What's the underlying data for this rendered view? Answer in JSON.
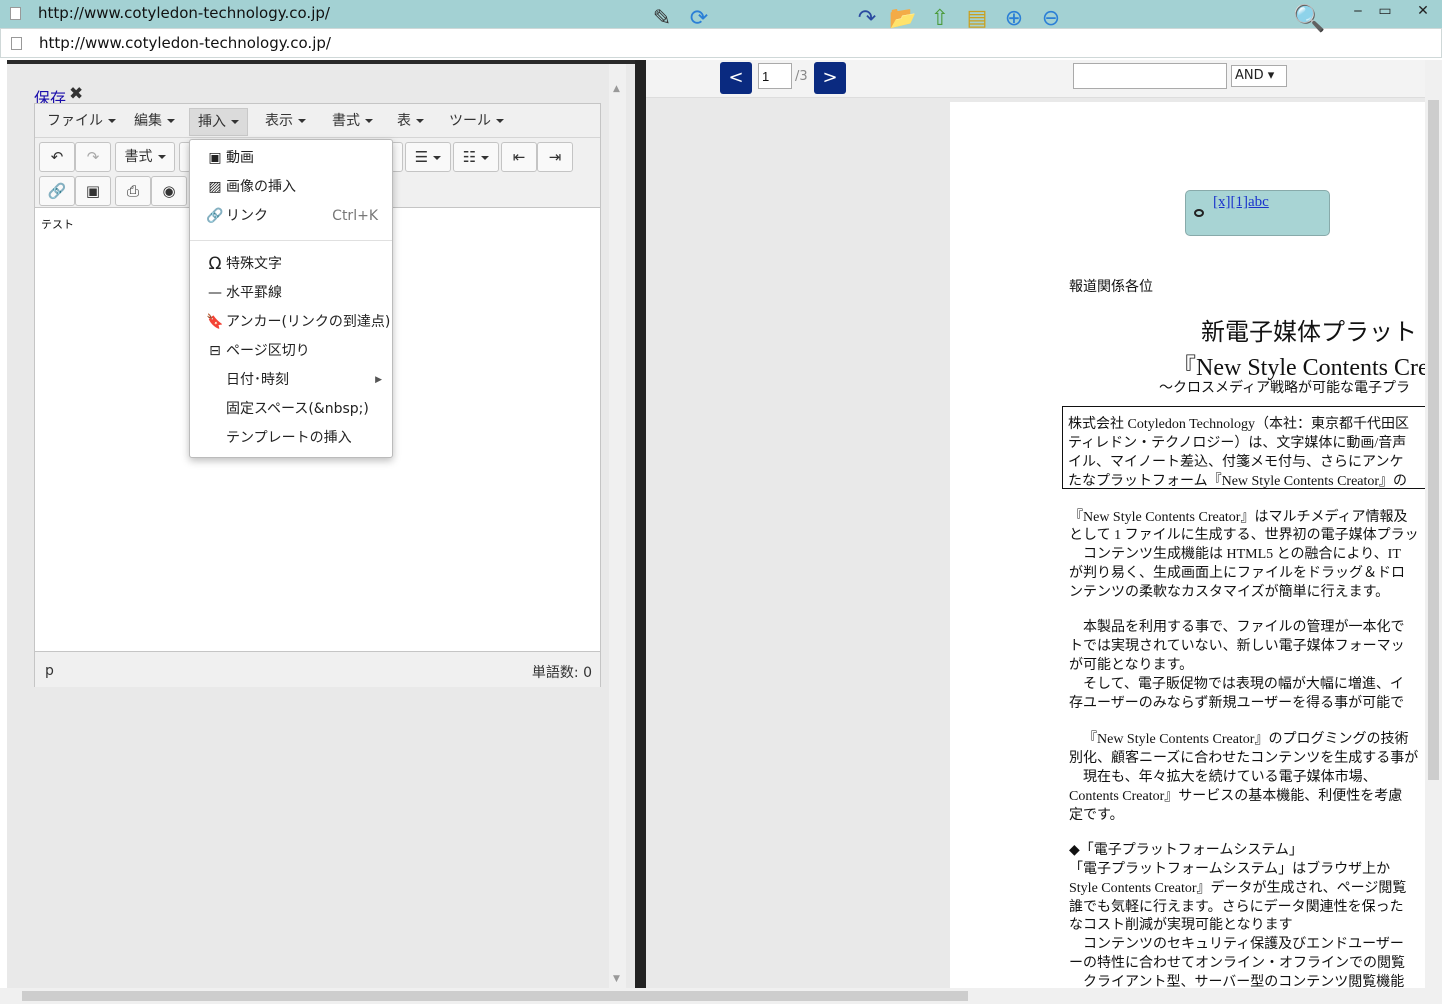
{
  "window": {
    "title": "http://www.cotyledon-technology.co.jp/",
    "min": "‒",
    "max": "▭",
    "close": "✕"
  },
  "address": {
    "url": "http://www.cotyledon-technology.co.jp/"
  },
  "editor": {
    "save_label": "保存",
    "close_glyph": "✖",
    "menus": [
      "ファイル",
      "編集",
      "挿入",
      "表示",
      "書式",
      "表",
      "ツール"
    ],
    "toolbar": {
      "format_label": "書式"
    },
    "content_text": "テスト",
    "status": {
      "path": "p",
      "word_count": "単語数: 0"
    }
  },
  "insert_menu": {
    "items": [
      {
        "icon": "video-icon",
        "label": "動画"
      },
      {
        "icon": "image-icon",
        "label": "画像の挿入"
      },
      {
        "icon": "link-icon",
        "label": "リンク",
        "shortcut": "Ctrl+K"
      },
      {
        "icon": "omega-icon",
        "label": "特殊文字"
      },
      {
        "icon": "hr-icon",
        "label": "水平罫線"
      },
      {
        "icon": "bookmark-icon",
        "label": "アンカー(リンクの到達点)"
      },
      {
        "icon": "pagebreak-icon",
        "label": "ページ区切り"
      },
      {
        "icon": "",
        "label": "日付･時刻"
      },
      {
        "icon": "",
        "label": "固定スペース(&nbsp;)"
      },
      {
        "icon": "",
        "label": "テンプレートの挿入"
      }
    ]
  },
  "viewer": {
    "page": "1",
    "page_total": "/3",
    "search_mode": "AND",
    "note_link": "[x][1]abc",
    "doc": {
      "l01": "報道関係各位",
      "l02": "新電子媒体プラット",
      "l03": "『New Style Contents Cre",
      "l04": "～クロスメディア戦略が可能な電子プラ",
      "l05": "株式会社 Cotyledon Technology（本社：東京都千代田区",
      "l06": "ティレドン・テクノロジー）は、文字媒体に動画/音声",
      "l07": "イル、マイノート差込、付箋メモ付与、さらにアンケ",
      "l08": "たなプラットフォーム『New Style Contents Creator』の",
      "l09": "『New Style Contents Creator』はマルチメディア情報及",
      "l10": "として 1 ファイルに生成する、世界初の電子媒体プラッ",
      "l11": "コンテンツ生成機能は HTML5 との融合により、IT",
      "l12": "が判り易く、生成画面上にファイルをドラッグ＆ドロ",
      "l13": "ンテンツの柔軟なカスタマイズが簡単に行えます。",
      "l14": "本製品を利用する事で、ファイルの管理が一本化で",
      "l15": "トでは実現されていない、新しい電子媒体フォーマッ",
      "l16": "が可能となります。",
      "l17": "そして、電子販促物では表現の幅が大幅に増進、イ",
      "l18": "存ユーザーのみならず新規ユーザーを得る事が可能で",
      "l19": "『New Style Contents Creator』のプログミングの技術",
      "l20": "別化、顧客ニーズに合わせたコンテンツを生成する事が",
      "l21": "現在も、年々拡大を続けている電子媒体市場、",
      "l22": "Contents Creator』サービスの基本機能、利便性を考慮",
      "l23": "定です。",
      "l24": "◆「電子プラットフォームシステム」",
      "l25": "「電子プラットフォームシステム」はブラウザ上か",
      "l26": "Style Contents Creator』データが生成され、ページ閲覧",
      "l27": "誰でも気軽に行えます。さらにデータ関連性を保った",
      "l28": "なコスト削減が実現可能となります",
      "l29": "コンテンツのセキュリティ保護及びエンドユーザー",
      "l30": "ーの特性に合わせてオンライン・オフラインでの閲覧",
      "l31": "クライアント型、サーバー型のコンテンツ閲覧機能"
    }
  }
}
